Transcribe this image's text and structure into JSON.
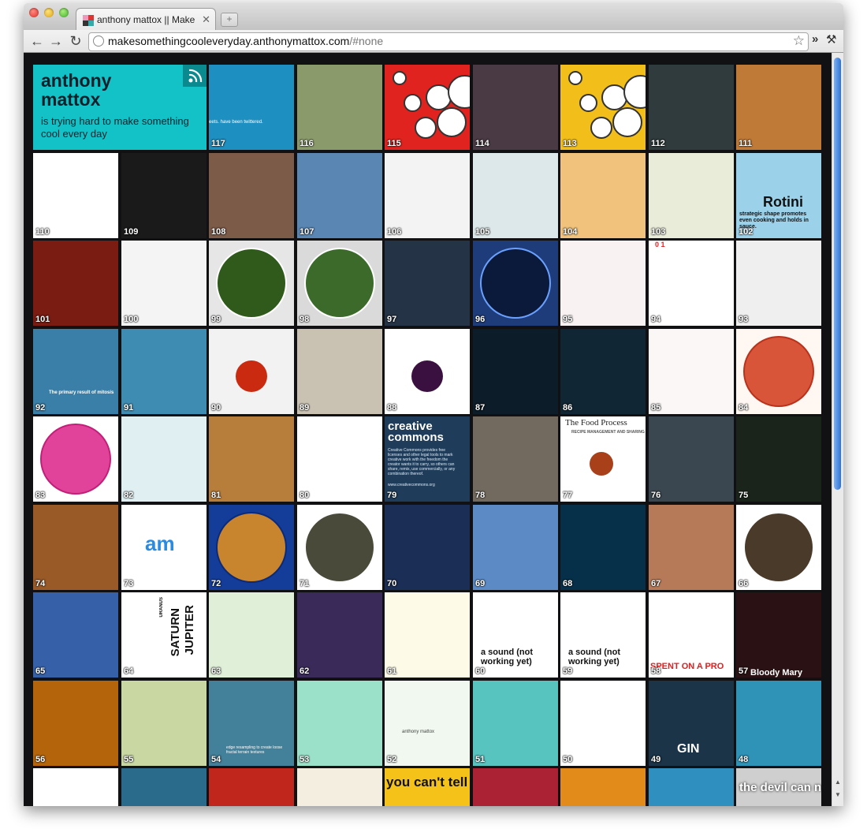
{
  "browser": {
    "tab_title": "anthony mattox || Make Something Cool Every Day",
    "tab_close": "✕",
    "new_tab": "+",
    "url_host": "makesomethingcooleveryday.anthonymattox.com",
    "url_path": "/#none",
    "icons": [
      "back-icon",
      "forward-icon",
      "reload-icon",
      "globe-icon",
      "star-icon",
      "chevron-icon",
      "wrench-icon"
    ]
  },
  "header": {
    "title": "anthony mattox",
    "subtitle": "is trying hard to make something cool every day"
  },
  "tile_captions": {
    "t102": "Rotini",
    "t102_sub": "strategic shape promotes even cooking and holds in sauce.",
    "t92": "The primary result of mitosis",
    "t79_title": "creative commons",
    "t79_body": "Creative Commons provides free licenses and other legal tools to mark creative work with the freedom the creator wants it to carry, so others can share, remix, use commercially, or any combination thereof.",
    "t79_url": "www.creativecommons.org",
    "t77_title": "The Food Process",
    "t77_sub": "RECIPE MANAGEMENT AND SHARING",
    "t94_labels": [
      "0",
      "1"
    ],
    "t73": "am",
    "t64_a": "SATURN",
    "t64_b": "JUPITER",
    "t64_c": "URANUS",
    "t60": "a sound (not working yet)",
    "t59": "a sound (not working yet)",
    "t58": "SPENT ON A PRO",
    "t57": "Bloody Mary",
    "t49": "GIN",
    "t54": "edge resampling to create loose fractal terrain textures",
    "t52": "anthony mattox",
    "t_partial_1": "you can't tell the difference",
    "t_partial_2": "the devil can not red",
    "t117": "eets. have been twittered."
  },
  "tiles": [
    {
      "n": "117",
      "c": "#1d8fc0"
    },
    {
      "n": "116",
      "c": "#8a9a6a"
    },
    {
      "n": "115",
      "c": "#e0231e"
    },
    {
      "n": "114",
      "c": "#4a3a44"
    },
    {
      "n": "113",
      "c": "#f2bf1a"
    },
    {
      "n": "112",
      "c": "#2f3b3c"
    },
    {
      "n": "111",
      "c": "#c07a38"
    },
    {
      "n": "110",
      "c": "#ffffff"
    },
    {
      "n": "109",
      "c": "#1a1a1a"
    },
    {
      "n": "108",
      "c": "#7c5b48"
    },
    {
      "n": "107",
      "c": "#5a86b4"
    },
    {
      "n": "106",
      "c": "#f3f3f3"
    },
    {
      "n": "105",
      "c": "#dce8ea"
    },
    {
      "n": "104",
      "c": "#f0c27c"
    },
    {
      "n": "103",
      "c": "#e9ecd8"
    },
    {
      "n": "102",
      "c": "#9cd1ea"
    },
    {
      "n": "101",
      "c": "#7a1c12"
    },
    {
      "n": "100",
      "c": "#f4f4f4"
    },
    {
      "n": "99",
      "c": "#e6e6e6"
    },
    {
      "n": "98",
      "c": "#dadada"
    },
    {
      "n": "97",
      "c": "#243346"
    },
    {
      "n": "96",
      "c": "#1e3c7a"
    },
    {
      "n": "95",
      "c": "#f8f2f2"
    },
    {
      "n": "94",
      "c": "#ffffff"
    },
    {
      "n": "93",
      "c": "#efefef"
    },
    {
      "n": "92",
      "c": "#3a7fa8"
    },
    {
      "n": "91",
      "c": "#3f8cb3"
    },
    {
      "n": "90",
      "c": "#f2f2f2"
    },
    {
      "n": "89",
      "c": "#c9c2b2"
    },
    {
      "n": "88",
      "c": "#ffffff"
    },
    {
      "n": "87",
      "c": "#0c1c28"
    },
    {
      "n": "86",
      "c": "#102634"
    },
    {
      "n": "85",
      "c": "#fbf7f7"
    },
    {
      "n": "84",
      "c": "#fff7f2"
    },
    {
      "n": "83",
      "c": "#ffffff"
    },
    {
      "n": "82",
      "c": "#dfeff2"
    },
    {
      "n": "81",
      "c": "#b77d3a"
    },
    {
      "n": "80",
      "c": "#ffffff"
    },
    {
      "n": "79",
      "c": "#1f3d5a"
    },
    {
      "n": "78",
      "c": "#726a5e"
    },
    {
      "n": "77",
      "c": "#ffffff"
    },
    {
      "n": "76",
      "c": "#3a4650"
    },
    {
      "n": "75",
      "c": "#1a241a"
    },
    {
      "n": "74",
      "c": "#9a5a28"
    },
    {
      "n": "73",
      "c": "#ffffff"
    },
    {
      "n": "72",
      "c": "#143d9a"
    },
    {
      "n": "71",
      "c": "#ffffff"
    },
    {
      "n": "70",
      "c": "#1b2e55"
    },
    {
      "n": "69",
      "c": "#5b8ac4"
    },
    {
      "n": "68",
      "c": "#06304a"
    },
    {
      "n": "67",
      "c": "#b67a58"
    },
    {
      "n": "66",
      "c": "#ffffff"
    },
    {
      "n": "65",
      "c": "#3660a8"
    },
    {
      "n": "64",
      "c": "#ffffff"
    },
    {
      "n": "63",
      "c": "#e0efd8"
    },
    {
      "n": "62",
      "c": "#3a2a5a"
    },
    {
      "n": "61",
      "c": "#fdfbe8"
    },
    {
      "n": "60",
      "c": "#ffffff"
    },
    {
      "n": "59",
      "c": "#ffffff"
    },
    {
      "n": "58",
      "c": "#ffffff"
    },
    {
      "n": "57",
      "c": "#2a1214"
    },
    {
      "n": "56",
      "c": "#b4650c"
    },
    {
      "n": "55",
      "c": "#c9d8a3"
    },
    {
      "n": "54",
      "c": "#43809a"
    },
    {
      "n": "53",
      "c": "#9be0c8"
    },
    {
      "n": "52",
      "c": "#f0f8f0"
    },
    {
      "n": "51",
      "c": "#58c4c0"
    },
    {
      "n": "50",
      "c": "#ffffff"
    },
    {
      "n": "49",
      "c": "#1b3448"
    },
    {
      "n": "48",
      "c": "#2f93b7"
    },
    {
      "n": "",
      "c": "#ffffff"
    },
    {
      "n": "",
      "c": "#2a6a8a"
    },
    {
      "n": "",
      "c": "#c0261c"
    },
    {
      "n": "",
      "c": "#f3eee0"
    },
    {
      "n": "",
      "c": "#f5c21a"
    },
    {
      "n": "",
      "c": "#aa2233"
    },
    {
      "n": "",
      "c": "#e28a1a"
    },
    {
      "n": "",
      "c": "#2f8fbe"
    },
    {
      "n": "",
      "c": "#cfcfcf"
    }
  ]
}
